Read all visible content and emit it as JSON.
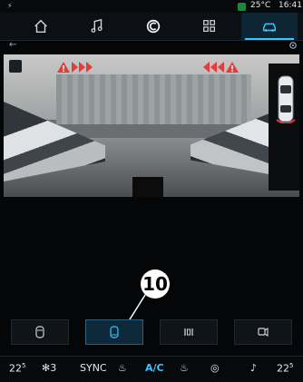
{
  "status": {
    "temperature": "25°C",
    "time": "16:41"
  },
  "nav": {
    "items": [
      {
        "name": "home-icon"
      },
      {
        "name": "music-icon"
      },
      {
        "name": "connect-icon",
        "glyph": "C"
      },
      {
        "name": "apps-icon"
      },
      {
        "name": "vehicle-icon"
      }
    ]
  },
  "callout": {
    "label": "10"
  },
  "climate": {
    "left_temp": "22",
    "left_temp_sub": "5",
    "fan_level": "3",
    "sync_label": "SYNC",
    "ac_label": "A/C",
    "right_temp": "22",
    "right_temp_sub": "5"
  },
  "colors": {
    "accent": "#3ec3ff",
    "warning": "#e53b3b",
    "status_green": "#1a8a3a"
  }
}
